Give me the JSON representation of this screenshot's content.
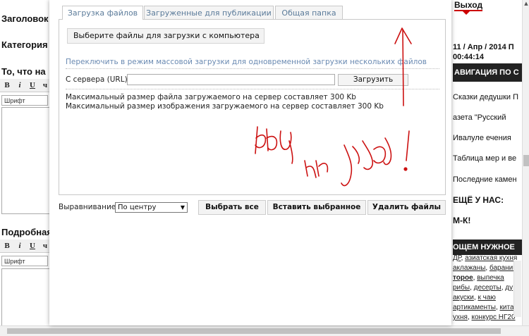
{
  "background_left": {
    "label_title": "Заголовок",
    "label_category": "Категория",
    "label_what": "То, что на",
    "label_detailed": "Подробная",
    "toolbar_b": "B",
    "toolbar_i": "i",
    "toolbar_u": "U",
    "toolbar_s": "ч",
    "font_select": "Шрифт"
  },
  "background_right": {
    "exit": "Выход",
    "date_line1": "11 / Апр / 2014 П",
    "date_line2": "00:44:14",
    "nav_header": "АВИГАЦИЯ ПО С",
    "nav_items": [
      "Сказки дедушки П",
      "азета \"Русский",
      "Ивалуле ечения",
      "Таблица мер и ве",
      "Последние камен"
    ],
    "more_us": "ЕЩЁ У НАС:",
    "mk": "М-К!",
    "needed_header": "ОЩЕМ НУЖНОЕ",
    "tags_line1_a": "ДР",
    "tags_line1_b": "азиатская кухня",
    "tags_line2_a": "аклажаны",
    "tags_line2_b": "баранин",
    "tags_line3_a": "торое",
    "tags_line3_b": "выпечка",
    "tags_line4_a": "рибы",
    "tags_line4_b": "десерты",
    "tags_line4_c": "ду",
    "tags_line5_a": "акуски",
    "tags_line5_b": "к чаю",
    "tags_line6_a": "артикаменты",
    "tags_line6_b": "кита",
    "tags_line7_a": "ухня",
    "tags_line7_b": "конкурс НГ20"
  },
  "dialog": {
    "tabs": [
      {
        "label": "Загрузка файлов",
        "active": true
      },
      {
        "label": "Загруженные для публикации",
        "active": false
      },
      {
        "label": "Общая папка",
        "active": false
      }
    ],
    "pick_files_button": "Выберите файлы для загрузки с компьютера",
    "bulk_mode_link": "Переключить в режим массовой загрузки для одновременной загрузки нескольких файлов",
    "url_label": "С сервера (URL):",
    "url_value": "",
    "upload_button": "Загрузить",
    "max_file_size": "Максимальный размер файла загружаемого на сервер составляет 300 Kb",
    "max_image_size": "Максимальный размер изображения загружаемого на сервер составляет 300 Kb",
    "align_label": "Выравнивание:",
    "align_value": "По центру",
    "select_all_button": "Выбрать все",
    "insert_selected_button": "Вставить выбранное",
    "delete_files_button": "Удалить файлы"
  },
  "colors": {
    "tab_text": "#5b7b9a",
    "link_text": "#6a8ab2",
    "annotation": "#cc1111"
  }
}
